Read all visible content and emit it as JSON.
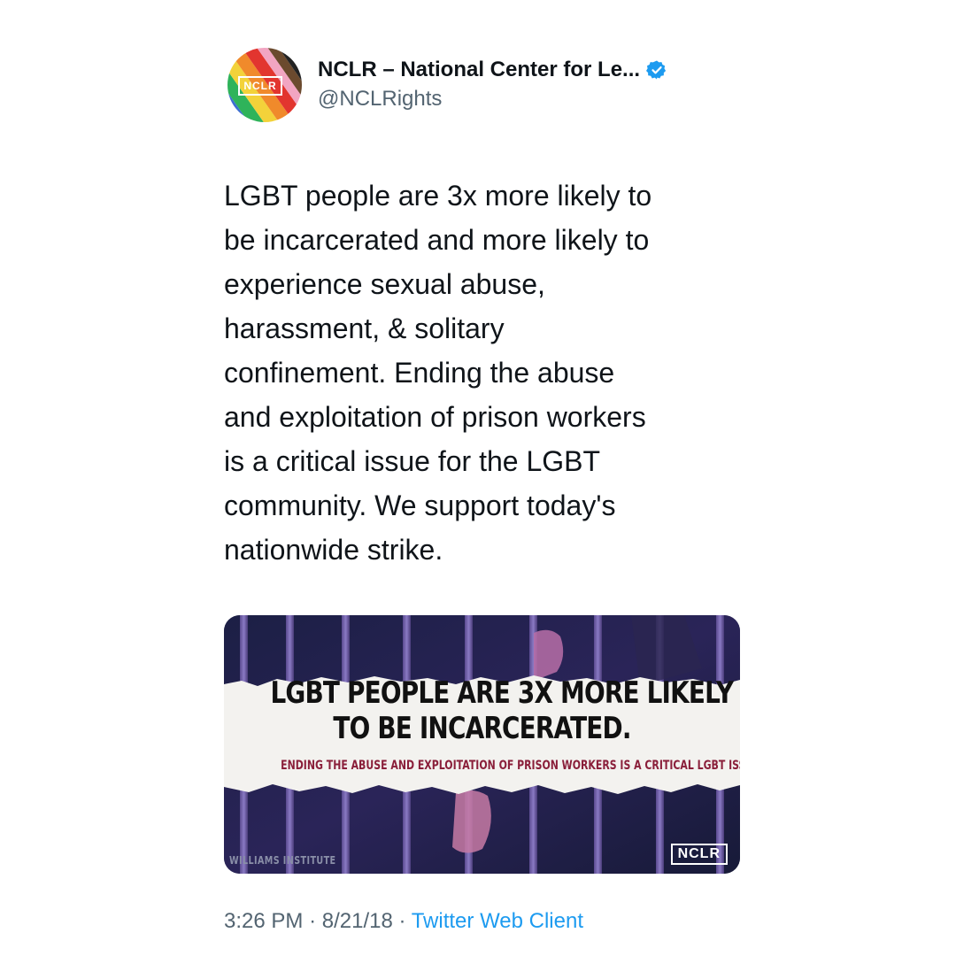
{
  "author": {
    "display_name": "NCLR – National Center for Le...",
    "handle": "@NCLRights",
    "avatar_label": "NCLR",
    "verified": true
  },
  "tweet": {
    "lines": [
      "LGBT people are 3x more likely to",
      "be incarcerated and more likely to",
      "experience sexual abuse,",
      "harassment, & solitary",
      "confinement. Ending the abuse",
      "and exploitation of prison workers",
      "is a critical issue for the LGBT",
      "community. We support today's",
      "nationwide strike."
    ]
  },
  "media": {
    "headline_line1": "LGBT PEOPLE ARE 3X MORE LIKELY",
    "headline_line2": "TO BE INCARCERATED.",
    "subline": "ENDING THE ABUSE AND EXPLOITATION OF PRISON WORKERS IS A CRITICAL LGBT ISSUE.",
    "credit": "WILLIAMS INSTITUTE",
    "logo": "NCLR"
  },
  "meta": {
    "time": "3:26 PM",
    "separator": "·",
    "date": "8/21/18",
    "source": "Twitter Web Client"
  },
  "colors": {
    "accent": "#1d9bf0",
    "secondary_text": "#536471",
    "subline_red": "#8a1f3a"
  }
}
